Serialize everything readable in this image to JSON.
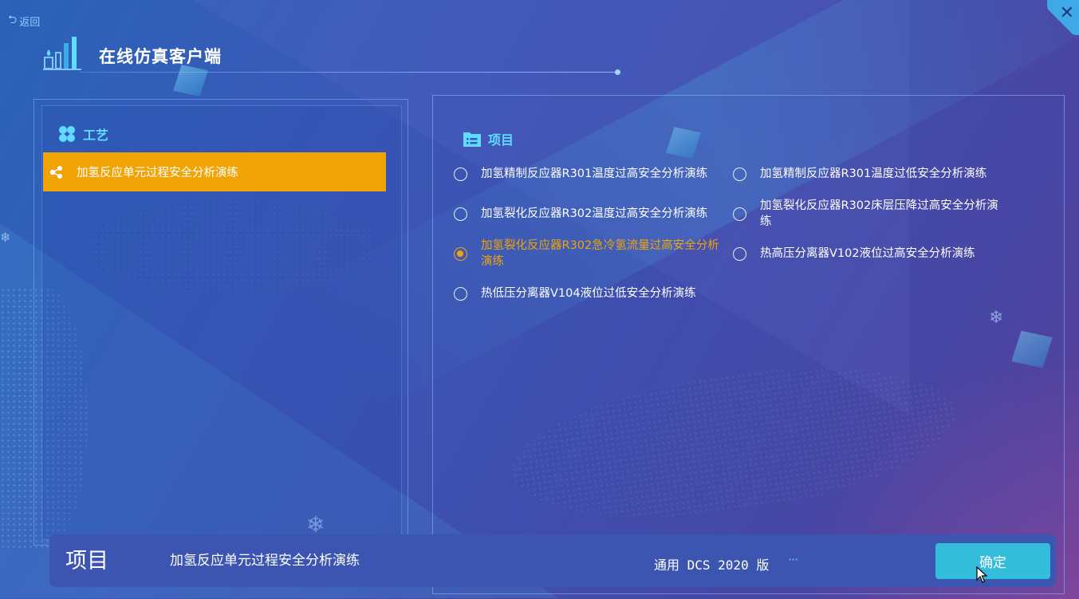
{
  "header": {
    "back_label": "返回",
    "app_title": "在线仿真客户端",
    "close_icon": "close-icon"
  },
  "colors": {
    "accent_orange": "#f0a408",
    "accent_cyan": "#5fdcff",
    "confirm_bg": "#34bcdb",
    "bar_bg": "#3c55b0"
  },
  "craft": {
    "title": "工艺",
    "icon": "petals-icon",
    "items": [
      {
        "label": "加氢反应单元过程安全分析演练",
        "icon": "share-nodes-icon",
        "selected": true
      }
    ]
  },
  "project": {
    "title": "项目",
    "icon": "folder-list-icon",
    "options": [
      {
        "label": "加氢精制反应器R301温度过高安全分析演练",
        "selected": false
      },
      {
        "label": "加氢精制反应器R301温度过低安全分析演练",
        "selected": false
      },
      {
        "label": "加氢裂化反应器R302温度过高安全分析演练",
        "selected": false
      },
      {
        "label": "加氢裂化反应器R302床层压降过高安全分析演练",
        "selected": false
      },
      {
        "label": "加氢裂化反应器R302急冷氢流量过高安全分析演练",
        "selected": true
      },
      {
        "label": "热高压分离器V102液位过高安全分析演练",
        "selected": false
      },
      {
        "label": "热低压分离器V104液位过低安全分析演练",
        "selected": false
      }
    ]
  },
  "footer": {
    "key_label": "项目",
    "value": "加氢反应单元过程安全分析演练",
    "version": "通用 DCS 2020 版",
    "more": "···",
    "confirm_label": "确定"
  }
}
